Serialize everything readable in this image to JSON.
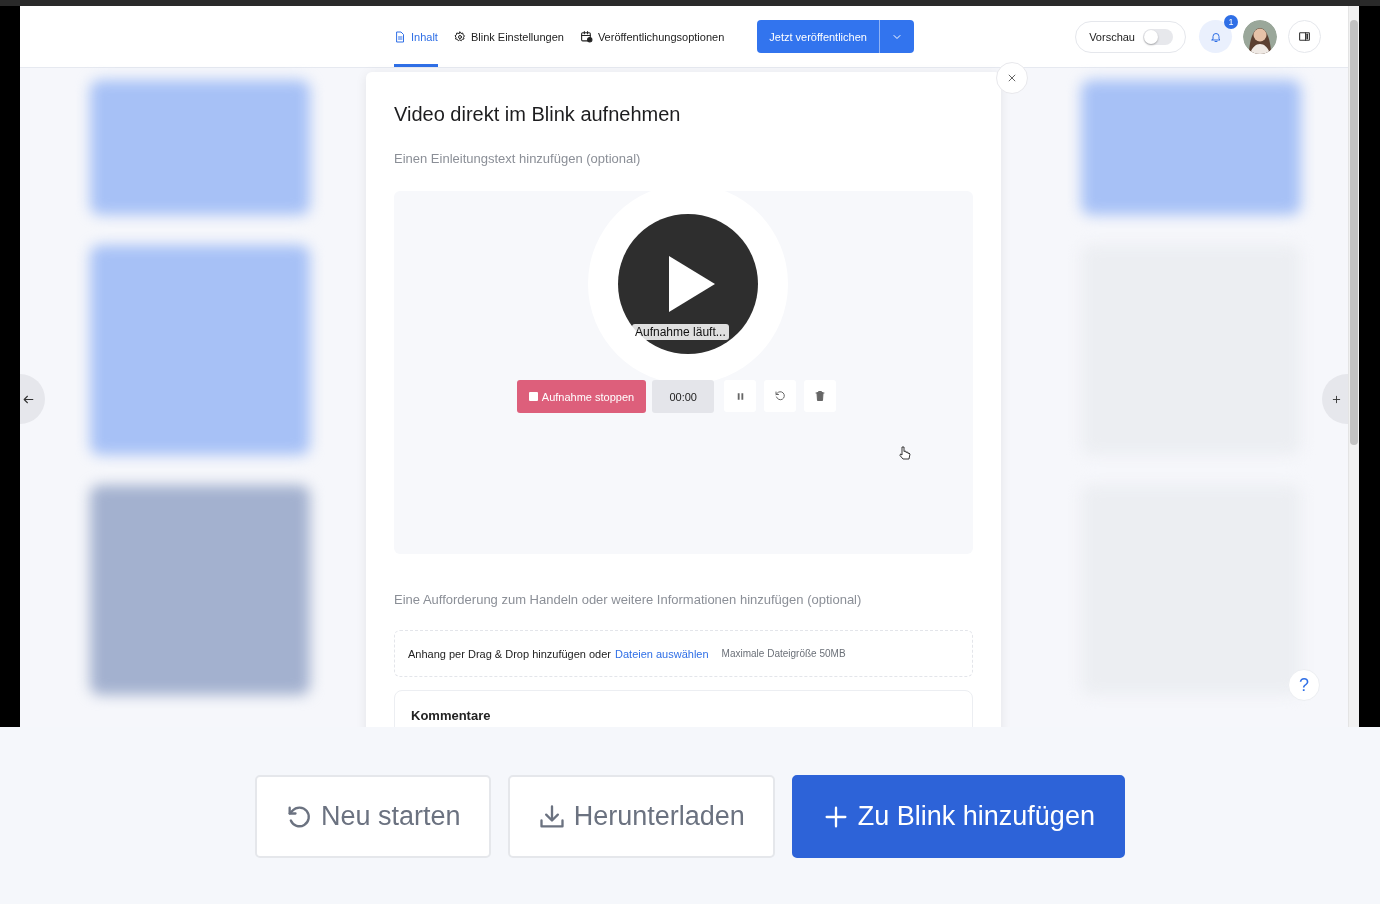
{
  "header": {
    "tabs": [
      {
        "label": "Inhalt",
        "selected": true
      },
      {
        "label": "Blink Einstellungen",
        "selected": false
      },
      {
        "label": "Veröffentlichungsoptionen",
        "selected": false
      }
    ],
    "publish_button": "Jetzt veröffentlichen",
    "preview_toggle": {
      "label": "Vorschau",
      "on": false
    },
    "notifications": {
      "count": "1"
    }
  },
  "modal": {
    "title": "Video direkt im Blink aufnehmen",
    "intro_placeholder": "Einen Einleitungstext hinzufügen (optional)",
    "recorder": {
      "status": "Aufnahme läuft...",
      "stop_label": "Aufnahme stoppen",
      "time": "00:00"
    },
    "cta_placeholder": "Eine Aufforderung zum Handeln oder weitere Informationen hinzufügen (optional)",
    "attachment": {
      "text": "Anhang per Drag & Drop hinzufügen oder",
      "link": "Dateien auswählen",
      "max_size": "Maximale Dateigröße 50MB"
    },
    "comments_title": "Kommentare"
  },
  "help": "?",
  "bottom_actions": [
    {
      "label": "Neu starten",
      "kind": "restart",
      "primary": false
    },
    {
      "label": "Herunterladen",
      "kind": "download",
      "primary": false
    },
    {
      "label": "Zu Blink hinzufügen",
      "kind": "add",
      "primary": true
    }
  ]
}
